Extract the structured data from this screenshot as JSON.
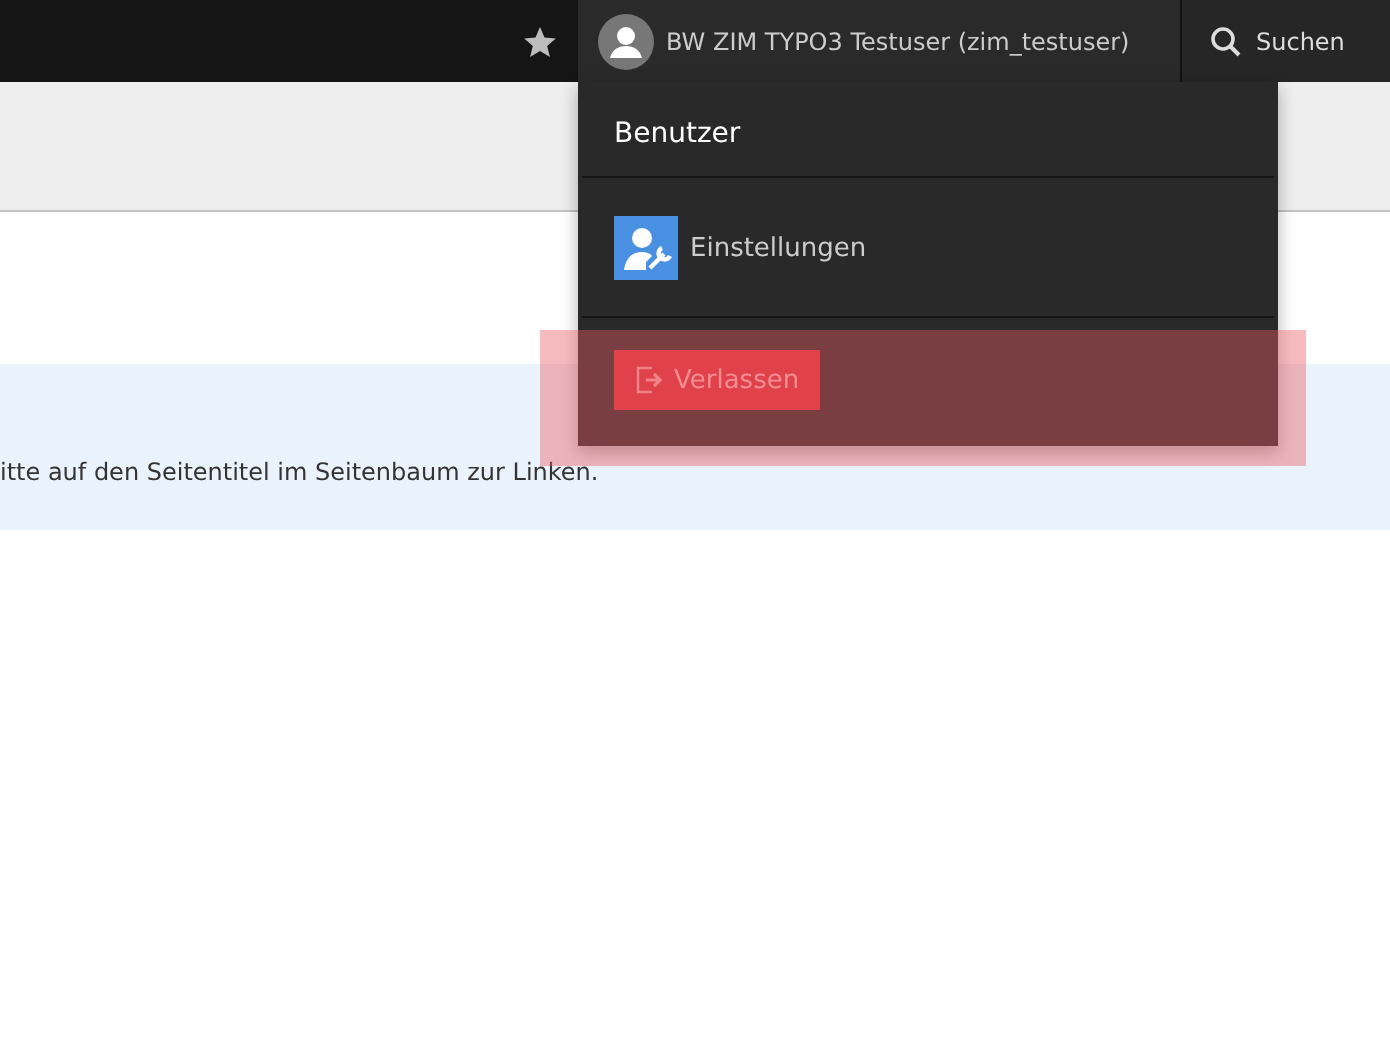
{
  "topbar": {
    "user_name": "BW ZIM TYPO3 Testuser (zim_testuser)",
    "search_label": "Suchen"
  },
  "user_menu": {
    "heading": "Benutzer",
    "items": [
      {
        "label": "Einstellungen"
      }
    ],
    "logout": {
      "label": "Verlassen",
      "highlighted": true
    }
  },
  "info": {
    "text": "itte auf den Seitentitel im Seitenbaum zur Linken."
  }
}
